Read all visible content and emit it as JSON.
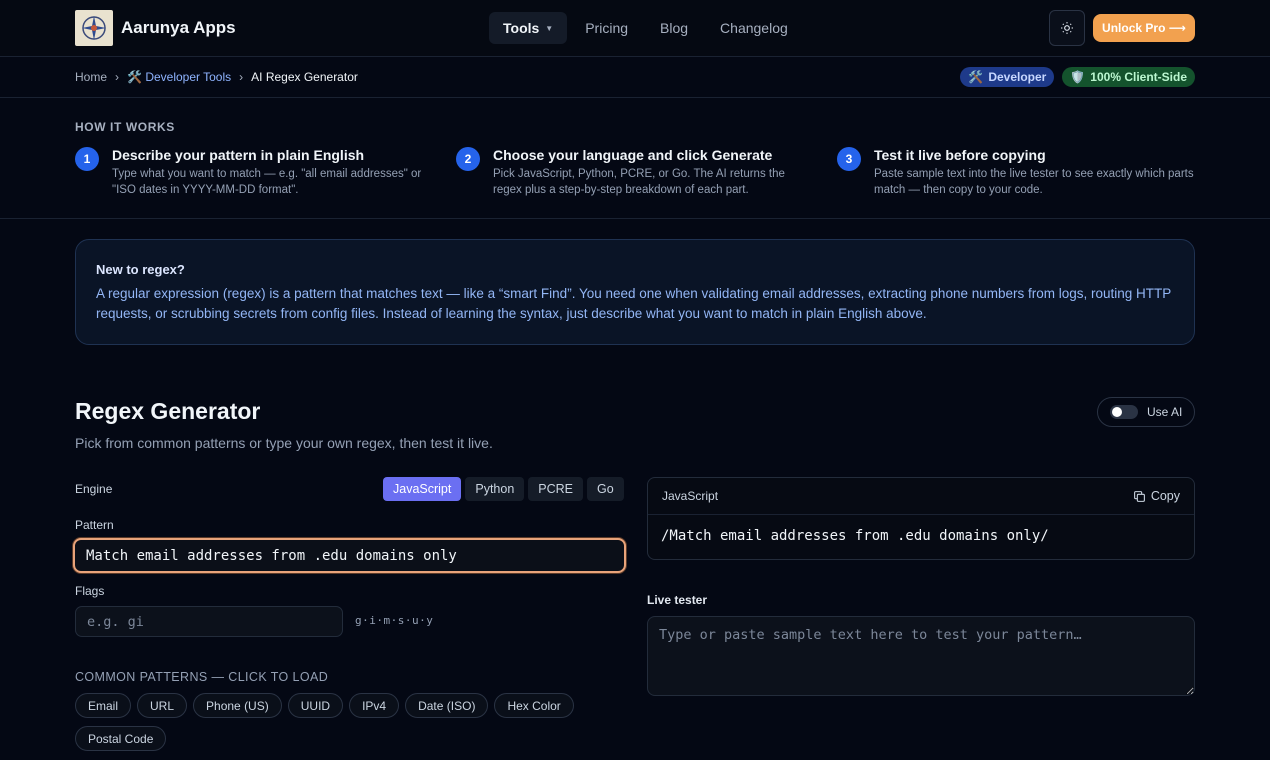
{
  "header": {
    "brand": "Aarunya Apps",
    "nav": [
      {
        "label": "Tools",
        "active": true
      },
      {
        "label": "Pricing"
      },
      {
        "label": "Blog"
      },
      {
        "label": "Changelog"
      }
    ],
    "cta": "Unlock Pro ⟶"
  },
  "breadcrumb": {
    "home": "Home",
    "category": "Developer Tools",
    "current": "AI Regex Generator",
    "sep": "›"
  },
  "badges": {
    "developer": "Developer",
    "client_side": "100% Client-Side"
  },
  "how_it_works": {
    "title": "HOW IT WORKS",
    "steps": [
      {
        "num": "1",
        "title": "Describe your pattern in plain English",
        "desc": "Type what you want to match — e.g. \"all email addresses\" or \"ISO dates in YYYY-MM-DD format\"."
      },
      {
        "num": "2",
        "title": "Choose your language and click Generate",
        "desc": "Pick JavaScript, Python, PCRE, or Go. The AI returns the regex plus a step-by-step breakdown of each part."
      },
      {
        "num": "3",
        "title": "Test it live before copying",
        "desc": "Paste sample text into the live tester to see exactly which parts match — then copy to your code."
      }
    ]
  },
  "intro": {
    "title": "New to regex?",
    "body": "A regular expression (regex) is a pattern that matches text — like a “smart Find”. You need one when validating email addresses, extracting phone numbers from logs, routing HTTP requests, or scrubbing secrets from config files. Instead of learning the syntax, just describe what you want to match in plain English above."
  },
  "generator": {
    "title": "Regex Generator",
    "subtitle": "Pick from common patterns or type your own regex, then test it live.",
    "use_ai_label": "Use AI",
    "engine_label": "Engine",
    "engines": [
      "JavaScript",
      "Python",
      "PCRE",
      "Go"
    ],
    "active_engine": "JavaScript",
    "pattern_label": "Pattern",
    "pattern_value": "Match email addresses from .edu domains only",
    "flags_label": "Flags",
    "flags_placeholder": "e.g. gi",
    "flags_hint": "g·i·m·s·u·y",
    "common_title": "COMMON PATTERNS — CLICK TO LOAD",
    "common_patterns": [
      "Email",
      "URL",
      "Phone (US)",
      "UUID",
      "IPv4",
      "Date (ISO)",
      "Hex Color",
      "Postal Code"
    ]
  },
  "output": {
    "engine": "JavaScript",
    "copy_label": "Copy",
    "regex": "/Match email addresses from .edu domains only/"
  },
  "tester": {
    "label": "Live tester",
    "placeholder": "Type or paste sample text here to test your pattern…"
  },
  "colors": {
    "accent": "#6b6ff2",
    "cta": "#f2a14f",
    "step": "#2563eb"
  }
}
